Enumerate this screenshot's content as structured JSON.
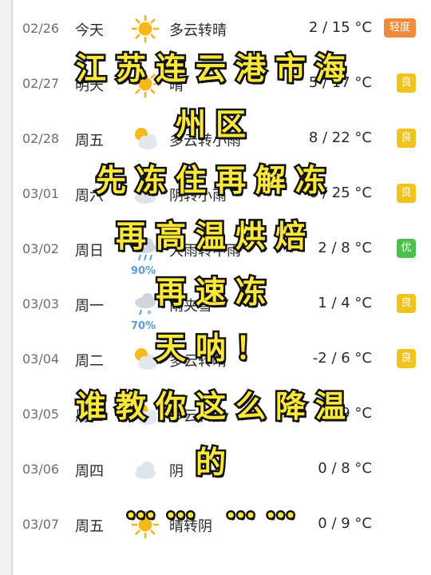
{
  "forecast": [
    {
      "date": "02/26",
      "day": "今天",
      "icon": "sun-icon",
      "condition": "多云转晴",
      "temp": "2 / 15 °C",
      "aqi": "轻度",
      "aqi_color": "#f08a3c"
    },
    {
      "date": "02/27",
      "day": "明天",
      "icon": "sun-icon",
      "condition": "晴",
      "temp": "5 / 17 °C",
      "aqi": "良",
      "aqi_color": "#f0c31f"
    },
    {
      "date": "02/28",
      "day": "周五",
      "icon": "partly-cloudy-icon",
      "condition": "多云转小雨",
      "temp": "8 / 22 °C",
      "aqi": "良",
      "aqi_color": "#f0c31f"
    },
    {
      "date": "03/01",
      "day": "周六",
      "icon": "cloud-icon",
      "condition": "阴转小雨",
      "temp": "6 / 25 °C",
      "aqi": "良",
      "aqi_color": "#f0c31f"
    },
    {
      "date": "03/02",
      "day": "周日",
      "icon": "rain-icon",
      "condition": "大雨转中雨",
      "temp": "2 / 8 °C",
      "aqi": "优",
      "aqi_color": "#4cbf4c",
      "precip": "90%"
    },
    {
      "date": "03/03",
      "day": "周一",
      "icon": "snow-icon",
      "condition": "雨夹雪",
      "temp": "1 / 4 °C",
      "aqi": "良",
      "aqi_color": "#f0c31f",
      "precip": "70%"
    },
    {
      "date": "03/04",
      "day": "周二",
      "icon": "partly-cloudy-icon",
      "condition": "多云转晴",
      "temp": "-2 / 6 °C",
      "aqi": "良",
      "aqi_color": "#f0c31f"
    },
    {
      "date": "03/05",
      "day": "周三",
      "icon": "partly-cloudy-icon",
      "condition": "多云转阴",
      "temp": "0 / 9 °C",
      "aqi": "",
      "aqi_color": ""
    },
    {
      "date": "03/06",
      "day": "周四",
      "icon": "cloud-icon",
      "condition": "阴",
      "temp": "0 / 8 °C",
      "aqi": "",
      "aqi_color": ""
    },
    {
      "date": "03/07",
      "day": "周五",
      "icon": "sun-icon",
      "condition": "晴转阴",
      "temp": "0 / 9 °C",
      "aqi": "",
      "aqi_color": ""
    }
  ],
  "overlay_lines": [
    "江苏连云港市海",
    "州区",
    "先冻住再解冻",
    "再高温烘焙",
    "再速冻",
    "天呐！",
    "谁教你这么降温",
    "的",
    "…… ……"
  ]
}
